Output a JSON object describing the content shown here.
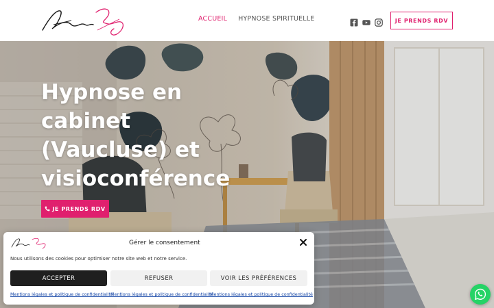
{
  "header": {
    "nav": [
      {
        "label": "ACCUEIL",
        "active": true
      },
      {
        "label": "HYPNOSE SPIRITUELLE",
        "active": false
      }
    ],
    "social_icons": [
      "facebook-icon",
      "youtube-icon",
      "instagram-icon"
    ],
    "cta_label": "JE PRENDS RDV"
  },
  "hero": {
    "title": "Hypnose en cabinet (Vaucluse) et visioconférence",
    "cta_label": "JE PRENDS RDV",
    "cta_icon": "phone-icon"
  },
  "cookie_banner": {
    "title": "Gérer le consentement",
    "text": "Nous utilisons des cookies pour optimiser notre site web et notre service.",
    "buttons": {
      "accept": "ACCEPTER",
      "refuse": "REFUSER",
      "preferences": "VOIR LES PRÉFÉRENCES"
    },
    "links": [
      "Mentions légales et politique de confidentialité",
      "Mentions légales et politique de confidentialité",
      "Mentions légales et politique de confidentialité"
    ]
  },
  "colors": {
    "accent": "#e0206e",
    "whatsapp": "#25d366",
    "dark_button": "#1f1f1f"
  }
}
